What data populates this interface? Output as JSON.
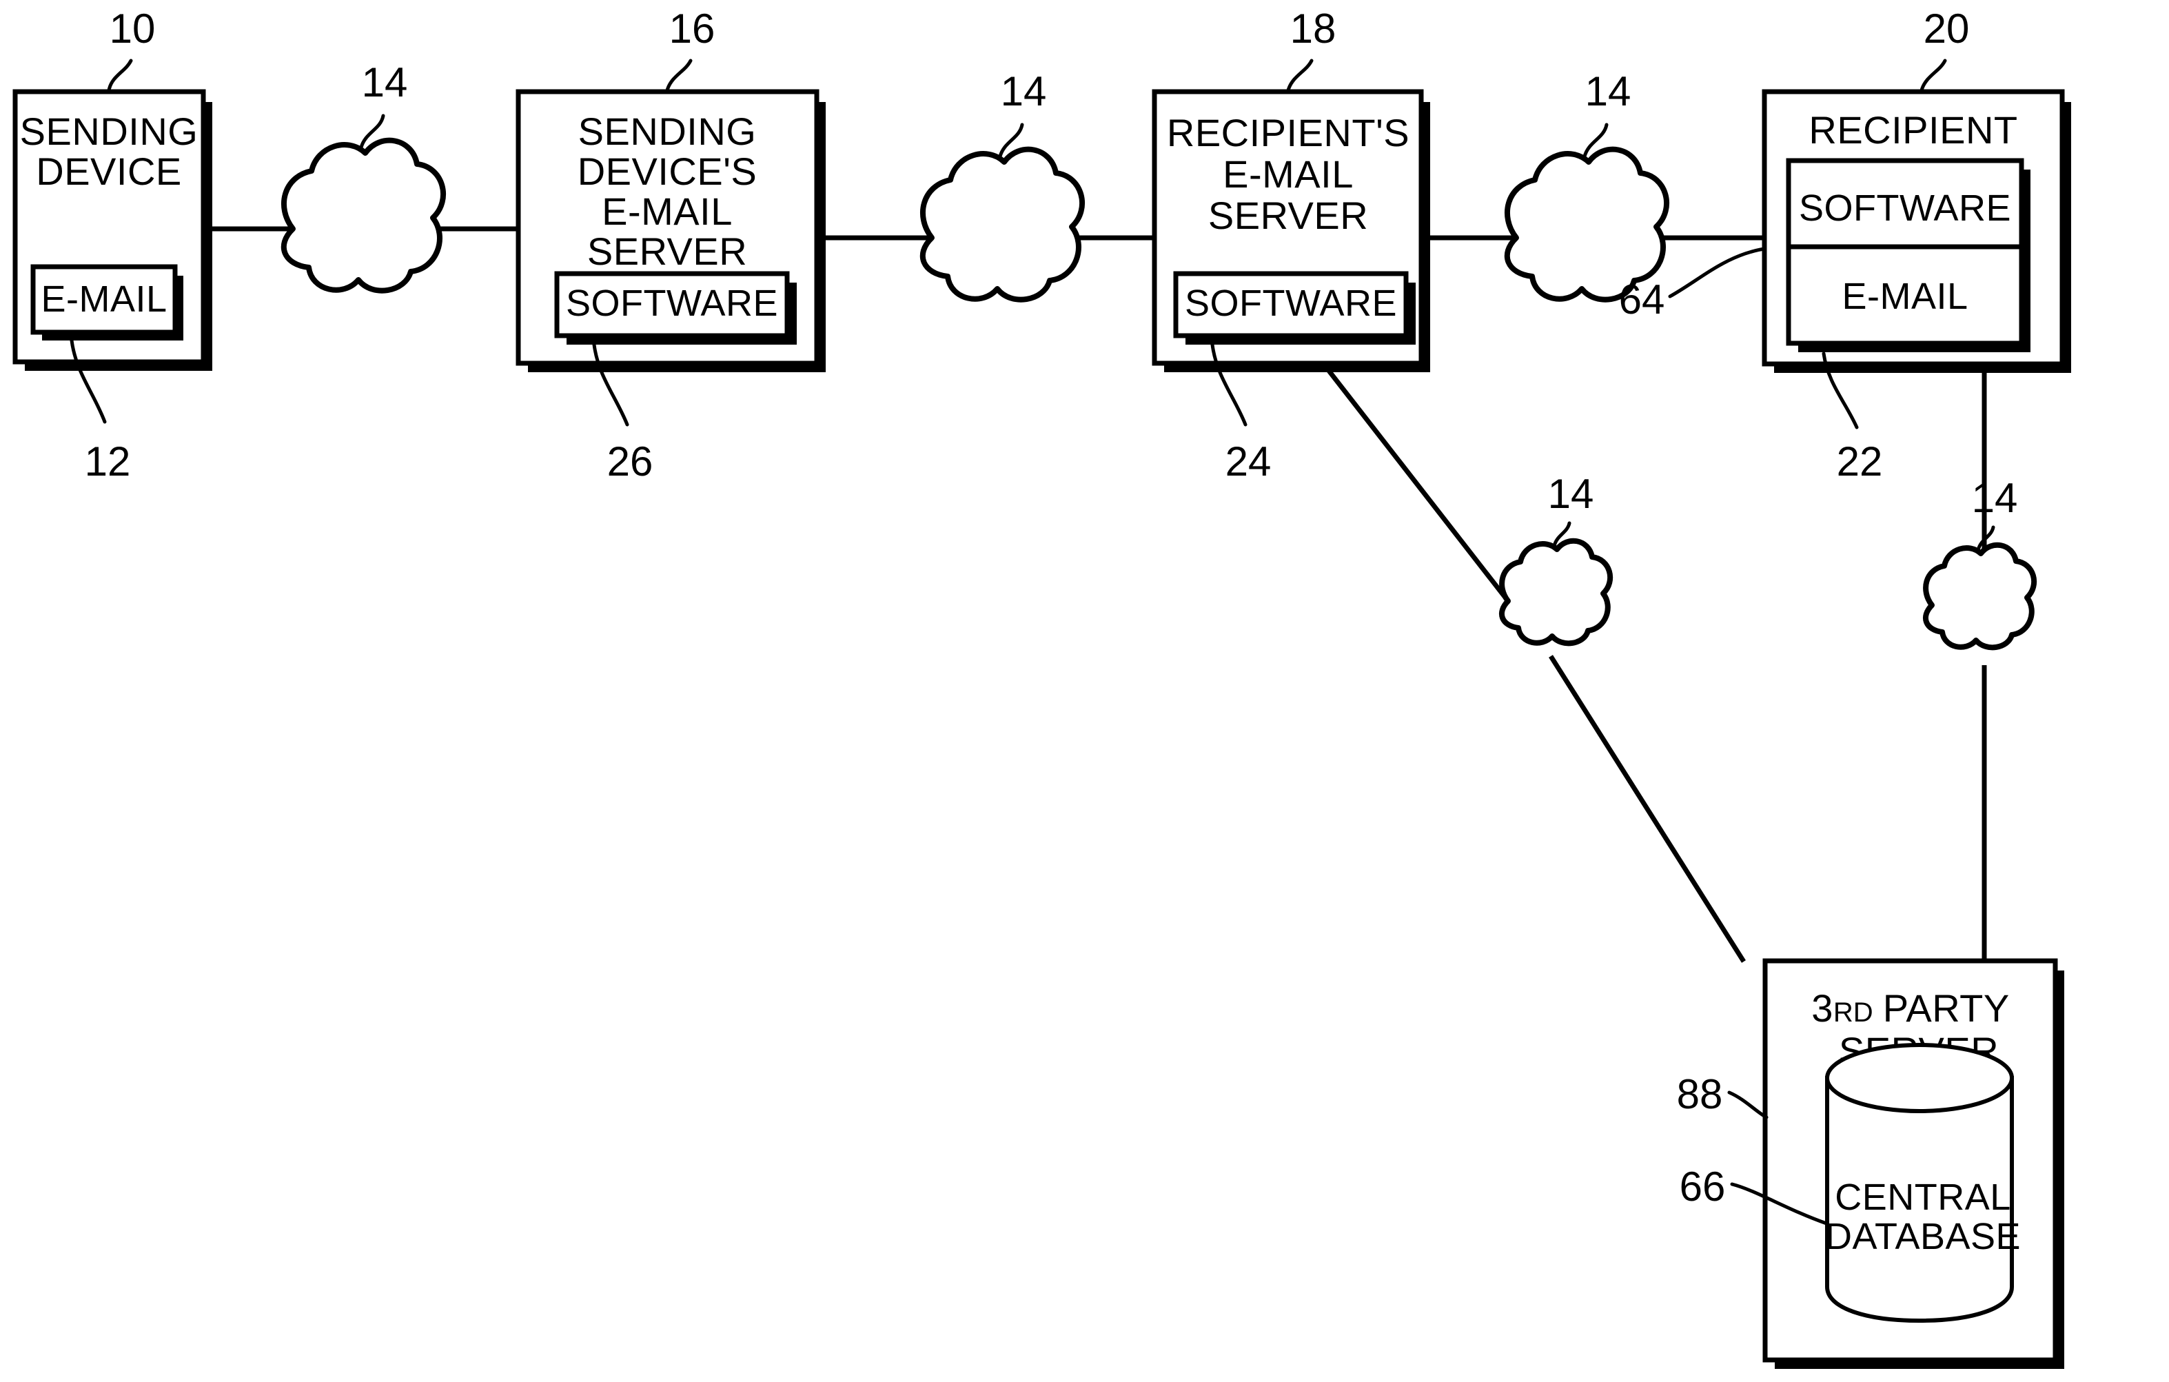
{
  "figure": {
    "type": "patent-block-diagram",
    "background": "#ffffff",
    "ink": "#000000"
  },
  "nodes": {
    "sending_device": {
      "ref": "10",
      "title_line1": "SENDING",
      "title_line2": "DEVICE",
      "inner": {
        "ref": "12",
        "label": "E-MAIL"
      }
    },
    "sending_server": {
      "ref": "16",
      "title_line1": "SENDING",
      "title_line2": "DEVICE'S",
      "title_line3": "E-MAIL",
      "title_line4": "SERVER",
      "inner": {
        "ref": "26",
        "label": "SOFTWARE"
      }
    },
    "recipient_server": {
      "ref": "18",
      "title_line1": "RECIPIENT'S",
      "title_line2": "E-MAIL",
      "title_line3": "SERVER",
      "inner": {
        "ref": "24",
        "label": "SOFTWARE"
      }
    },
    "recipient": {
      "ref": "20",
      "title": "RECIPIENT",
      "inner_ref": "64",
      "inner_top": {
        "ref": "22",
        "label": "SOFTWARE"
      },
      "inner_bottom": {
        "label": "E-MAIL"
      }
    },
    "third_party_server": {
      "ref": "88",
      "title_number": "3",
      "title_ordinal": "RD",
      "title_word": "PARTY",
      "title_line2": "SERVER",
      "database": {
        "ref": "66",
        "label_line1": "CENTRAL",
        "label_line2": "DATABASE"
      }
    }
  },
  "networks": [
    {
      "ref": "14",
      "name": "network-cloud-1"
    },
    {
      "ref": "14",
      "name": "network-cloud-2"
    },
    {
      "ref": "14",
      "name": "network-cloud-3"
    },
    {
      "ref": "14",
      "name": "network-cloud-4"
    },
    {
      "ref": "14",
      "name": "network-cloud-5"
    }
  ]
}
